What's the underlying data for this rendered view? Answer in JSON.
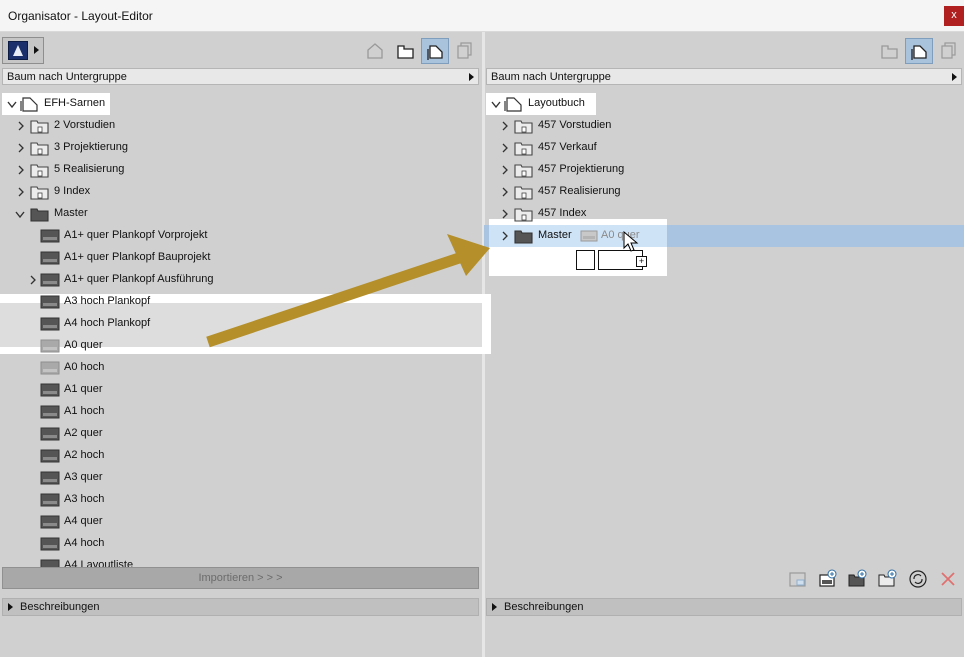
{
  "window": {
    "title": "Organisator - Layout-Editor",
    "close_label": "x"
  },
  "left": {
    "group_label": "Baum nach Untergruppe",
    "root": "EFH-Sarnen",
    "items": [
      {
        "label": "2 Vorstudien"
      },
      {
        "label": "3 Projektierung"
      },
      {
        "label": "5 Realisierung"
      },
      {
        "label": "9 Index"
      },
      {
        "label": "Master"
      }
    ],
    "masters": [
      {
        "label": "A1+ quer Plankopf Vorprojekt"
      },
      {
        "label": "A1+ quer Plankopf Bauprojekt"
      },
      {
        "label": "A1+ quer Plankopf Ausführung"
      },
      {
        "label": "A3 hoch Plankopf"
      },
      {
        "label": "A4 hoch Plankopf"
      },
      {
        "label": "A0 quer"
      },
      {
        "label": "A0 hoch"
      },
      {
        "label": "A1 quer"
      },
      {
        "label": "A1 hoch"
      },
      {
        "label": "A2 quer"
      },
      {
        "label": "A2 hoch"
      },
      {
        "label": "A3 quer"
      },
      {
        "label": "A3 hoch"
      },
      {
        "label": "A4 quer"
      },
      {
        "label": "A4 hoch"
      },
      {
        "label": "A4 Layoutliste"
      }
    ],
    "import_label": "Importieren > > >",
    "desc_label": "Beschreibungen"
  },
  "right": {
    "group_label": "Baum nach Untergruppe",
    "root": "Layoutbuch",
    "items": [
      {
        "label": "457 Vorstudien"
      },
      {
        "label": "457 Verkauf"
      },
      {
        "label": "457 Projektierung"
      },
      {
        "label": "457 Realisierung"
      },
      {
        "label": "457 Index"
      },
      {
        "label": "Master"
      }
    ],
    "drag_label": "A0 quer",
    "desc_label": "Beschreibungen"
  },
  "colors": {
    "arrow": "#b48f2a",
    "selection": "#a8c4e0",
    "close": "#b12020"
  }
}
